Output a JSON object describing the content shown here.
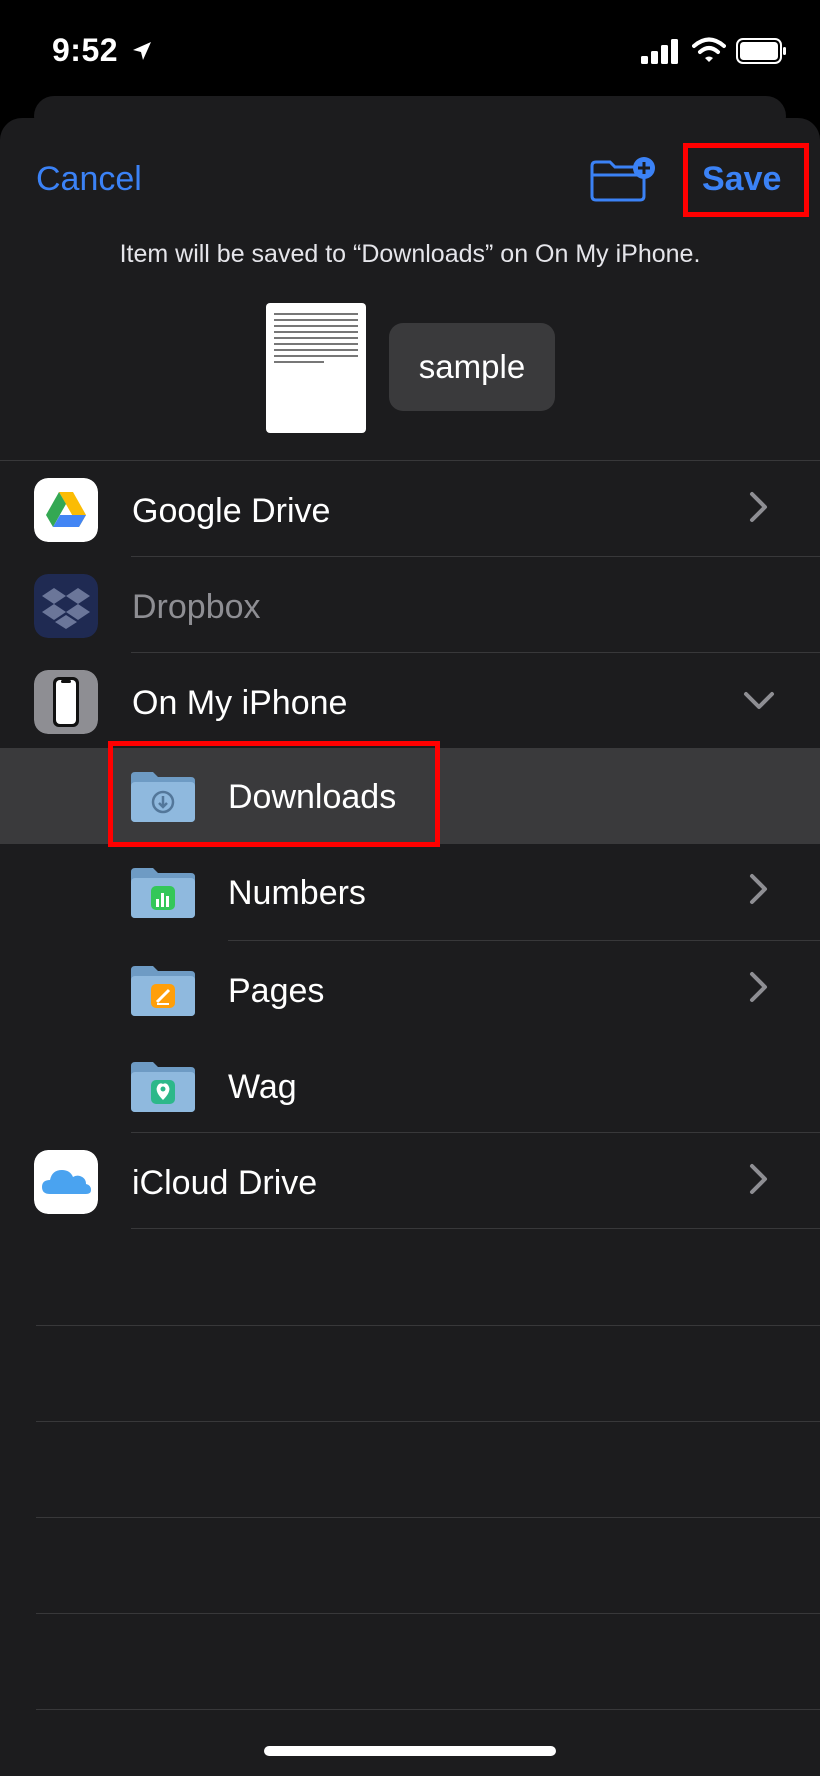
{
  "status_bar": {
    "time": "9:52"
  },
  "nav": {
    "cancel_label": "Cancel",
    "save_label": "Save"
  },
  "info_text": "Item will be saved to “Downloads” on On My iPhone.",
  "file": {
    "name": "sample"
  },
  "locations": [
    {
      "label": "Google Drive",
      "icon": "google-drive-icon",
      "accessory": "chevron-right"
    },
    {
      "label": "Dropbox",
      "icon": "dropbox-icon",
      "disabled": true
    },
    {
      "label": "On My iPhone",
      "icon": "iphone-icon",
      "accessory": "chevron-down"
    }
  ],
  "folders": [
    {
      "label": "Downloads",
      "icon": "downloads-folder-icon",
      "selected": true
    },
    {
      "label": "Numbers",
      "icon": "numbers-folder-icon",
      "accessory": "chevron-right"
    },
    {
      "label": "Pages",
      "icon": "pages-folder-icon",
      "accessory": "chevron-right"
    },
    {
      "label": "Wag",
      "icon": "wag-folder-icon"
    }
  ],
  "icloud": {
    "label": "iCloud Drive",
    "icon": "icloud-icon",
    "accessory": "chevron-right"
  },
  "colors": {
    "accent": "#3b82f6",
    "highlight_box": "#ff0000",
    "sheet_bg": "#1c1c1e",
    "selected_row": "#3a3a3c"
  }
}
